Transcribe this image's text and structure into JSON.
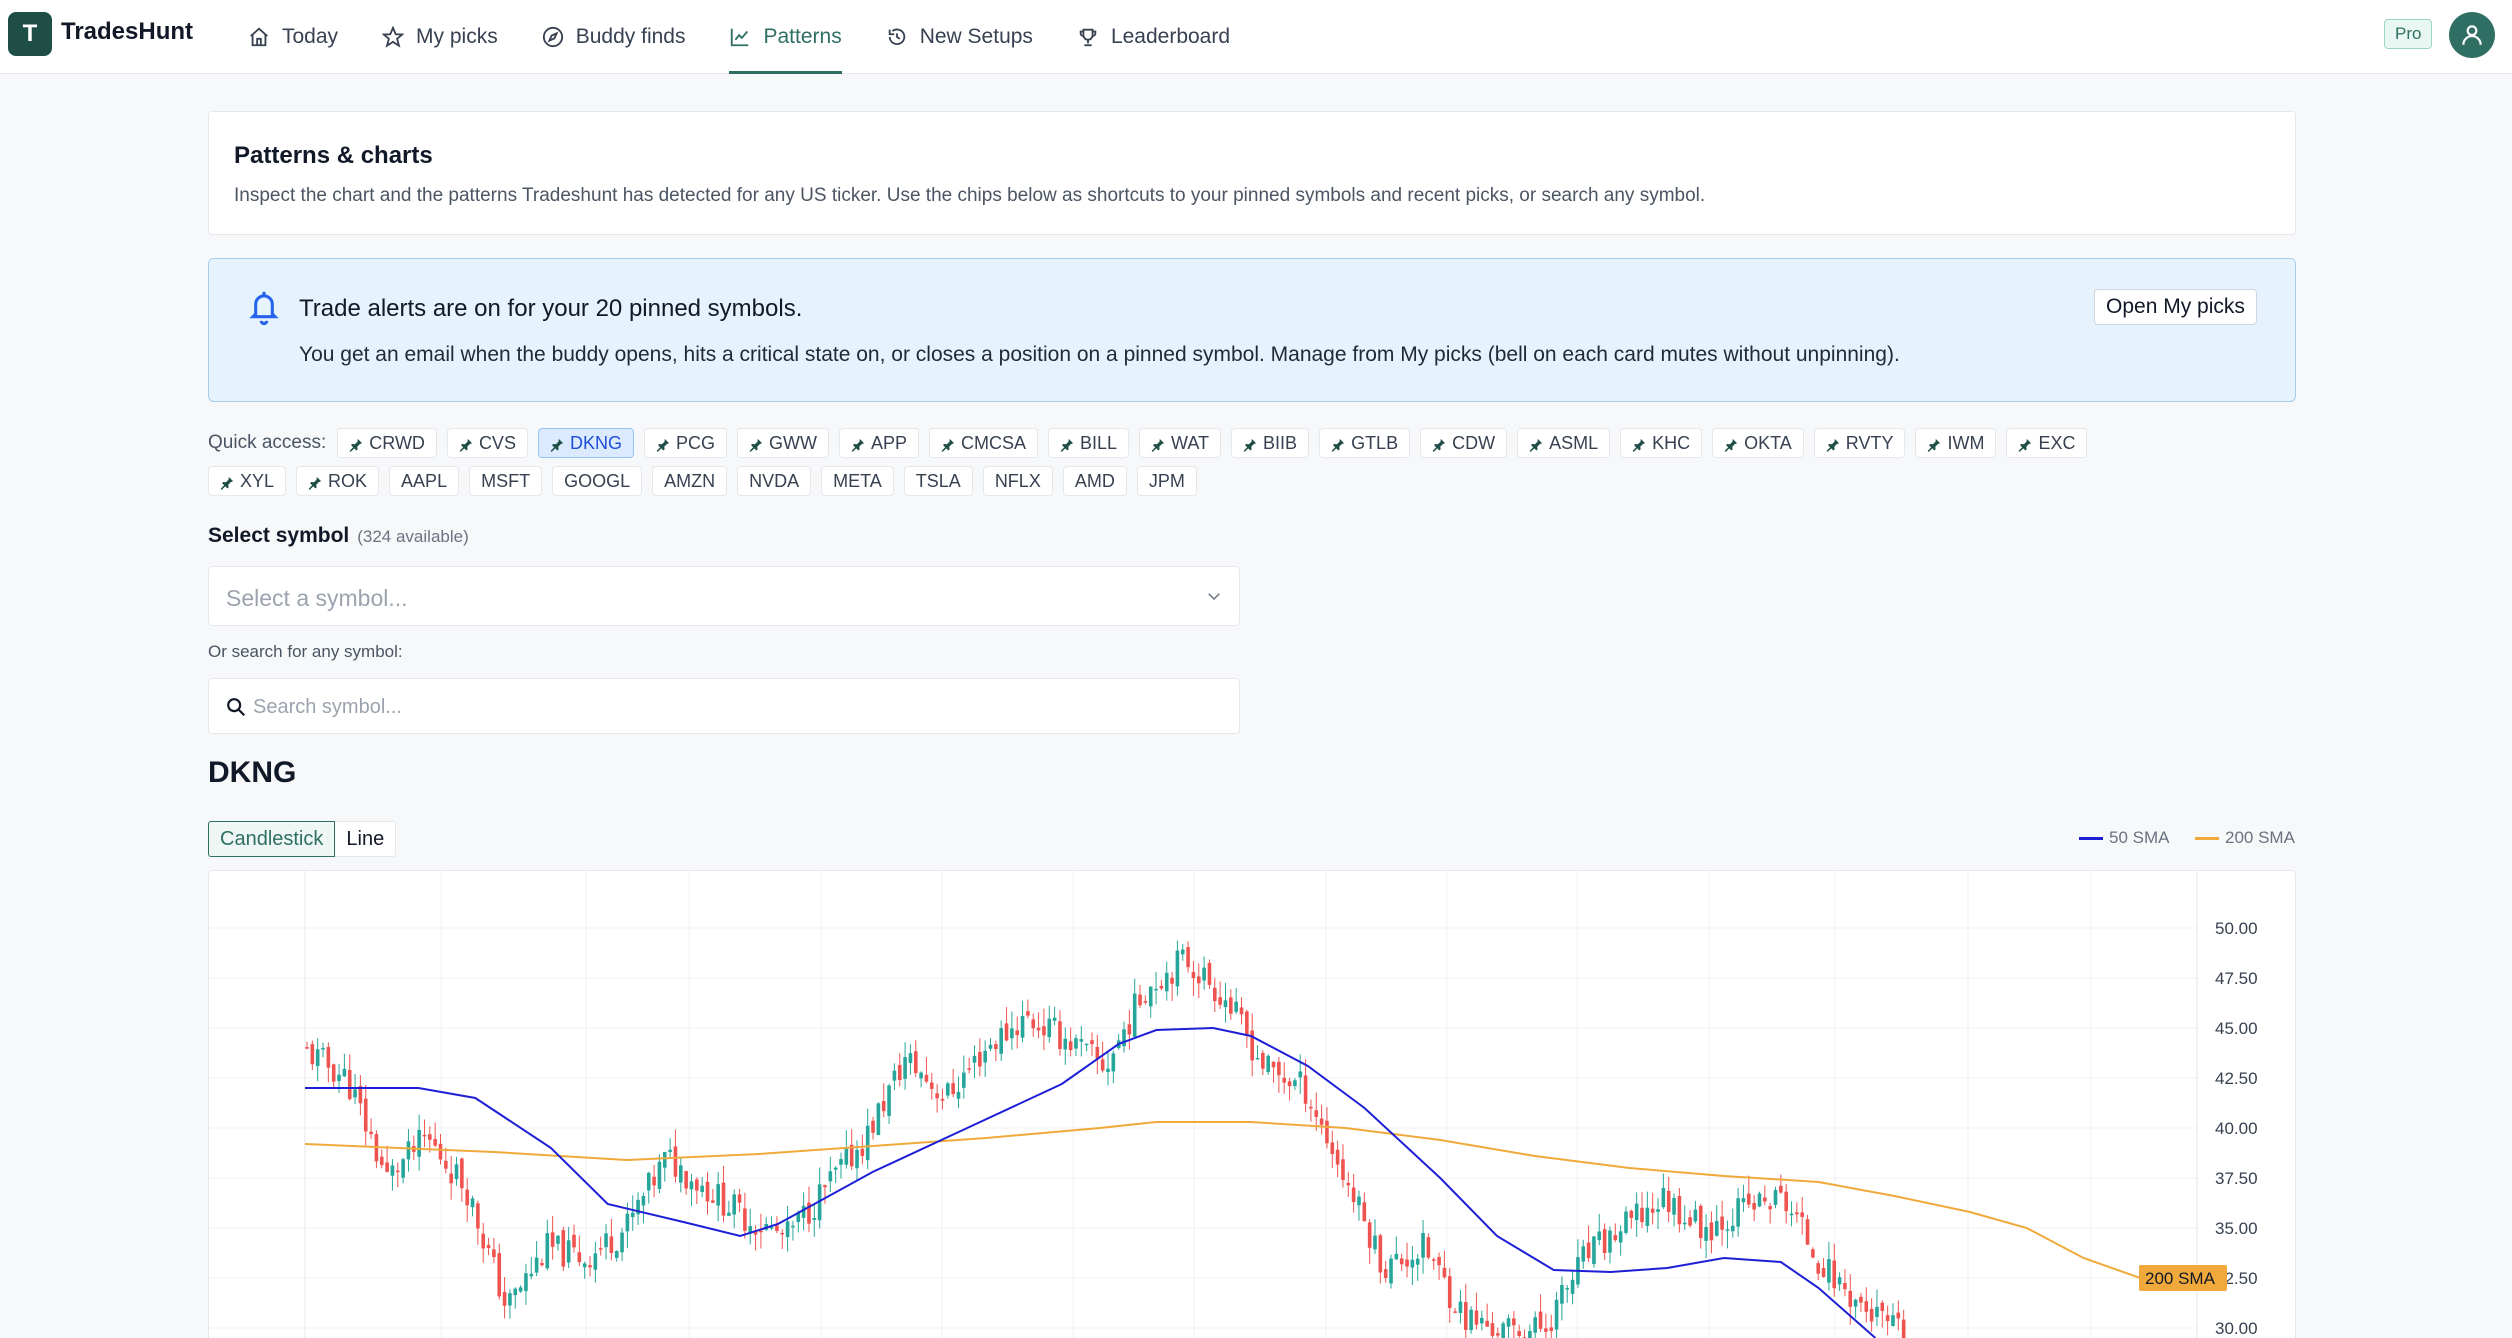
{
  "app": {
    "logo_letter": "T",
    "name": "TradesHunt"
  },
  "nav": [
    {
      "label": "Today",
      "icon": "home-icon",
      "active": false
    },
    {
      "label": "My picks",
      "icon": "star-icon",
      "active": false
    },
    {
      "label": "Buddy finds",
      "icon": "compass-icon",
      "active": false
    },
    {
      "label": "Patterns",
      "icon": "chart-line-icon",
      "active": true
    },
    {
      "label": "New Setups",
      "icon": "history-icon",
      "active": false
    },
    {
      "label": "Leaderboard",
      "icon": "trophy-icon",
      "active": false
    }
  ],
  "badge": "Pro",
  "intro": {
    "title": "Patterns & charts",
    "text": "Inspect the chart and the patterns Tradeshunt has detected for any US ticker. Use the chips below as shortcuts to your pinned symbols and recent picks, or search any symbol."
  },
  "alert": {
    "title": "Trade alerts are on for your 20 pinned symbols.",
    "body": "You get an email when the buddy opens, hits a critical state on, or closes a position on a pinned symbol. Manage from My picks (bell on each card mutes without unpinning).",
    "button": "Open My picks"
  },
  "quick_access": {
    "label": "Quick access:",
    "selected": "DKNG",
    "pinned": [
      "CRWD",
      "CVS",
      "DKNG",
      "PCG",
      "GWW",
      "APP",
      "CMCSA",
      "BILL",
      "WAT",
      "BIIB",
      "GTLB",
      "CDW",
      "ASML",
      "KHC",
      "OKTA",
      "RVTY",
      "IWM",
      "EXC",
      "XYL",
      "ROK"
    ],
    "recent": [
      "AAPL",
      "MSFT",
      "GOOGL",
      "AMZN",
      "NVDA",
      "META",
      "TSLA",
      "NFLX",
      "AMD",
      "JPM"
    ]
  },
  "selector": {
    "label": "Select symbol",
    "available": "(324 available)",
    "placeholder": "Select a symbol...",
    "or_label": "Or search for any symbol:",
    "search_placeholder": "Search symbol..."
  },
  "symbol": "DKNG",
  "chart_toggle": {
    "options": [
      "Candlestick",
      "Line"
    ],
    "selected": "Candlestick"
  },
  "legend": [
    {
      "label": "50 SMA",
      "color": "#1d1fd6"
    },
    {
      "label": "200 SMA",
      "color": "#f0a93a"
    }
  ],
  "chart_data": {
    "type": "candlestick",
    "symbol": "DKNG",
    "y_ticks": [
      "50.00",
      "47.50",
      "45.00",
      "42.50",
      "40.00",
      "37.50",
      "35.00",
      "32.50",
      "30.00"
    ],
    "ylim": [
      29.5,
      51
    ],
    "y_axis_position": "right",
    "grid": true,
    "up_color": "#26a69a",
    "down_color": "#ef5350",
    "close_anchors": [
      43.8,
      42.5,
      37.5,
      39.5,
      37.0,
      31.0,
      34.0,
      33.5,
      35.0,
      38.5,
      37.0,
      35.5,
      34.5,
      37.0,
      39.5,
      43.5,
      41.5,
      44.0,
      45.5,
      44.5,
      43.0,
      47.0,
      48.5,
      46.5,
      43.0,
      42.0,
      37.5,
      33.0,
      34.0,
      30.5,
      29.8,
      30.0,
      33.5,
      35.0,
      36.5,
      35.0,
      36.0,
      36.5,
      33.0,
      31.0,
      29.5
    ],
    "sma50": [
      {
        "x": 0,
        "y": 42.0
      },
      {
        "x": 0.06,
        "y": 42.0
      },
      {
        "x": 0.09,
        "y": 41.5
      },
      {
        "x": 0.13,
        "y": 39.0
      },
      {
        "x": 0.16,
        "y": 36.2
      },
      {
        "x": 0.2,
        "y": 35.3
      },
      {
        "x": 0.23,
        "y": 34.6
      },
      {
        "x": 0.25,
        "y": 35.2
      },
      {
        "x": 0.3,
        "y": 37.8
      },
      {
        "x": 0.35,
        "y": 40.0
      },
      {
        "x": 0.4,
        "y": 42.2
      },
      {
        "x": 0.43,
        "y": 44.2
      },
      {
        "x": 0.45,
        "y": 44.9
      },
      {
        "x": 0.48,
        "y": 45.0
      },
      {
        "x": 0.5,
        "y": 44.6
      },
      {
        "x": 0.53,
        "y": 43.1
      },
      {
        "x": 0.56,
        "y": 41.0
      },
      {
        "x": 0.6,
        "y": 37.5
      },
      {
        "x": 0.63,
        "y": 34.6
      },
      {
        "x": 0.66,
        "y": 32.9
      },
      {
        "x": 0.69,
        "y": 32.8
      },
      {
        "x": 0.72,
        "y": 33.0
      },
      {
        "x": 0.75,
        "y": 33.5
      },
      {
        "x": 0.78,
        "y": 33.3
      },
      {
        "x": 0.8,
        "y": 32.0
      },
      {
        "x": 0.83,
        "y": 29.5
      }
    ],
    "sma200": [
      {
        "x": 0,
        "y": 39.2
      },
      {
        "x": 0.1,
        "y": 38.8
      },
      {
        "x": 0.17,
        "y": 38.4
      },
      {
        "x": 0.24,
        "y": 38.7
      },
      {
        "x": 0.3,
        "y": 39.1
      },
      {
        "x": 0.36,
        "y": 39.5
      },
      {
        "x": 0.42,
        "y": 40.0
      },
      {
        "x": 0.45,
        "y": 40.3
      },
      {
        "x": 0.5,
        "y": 40.3
      },
      {
        "x": 0.55,
        "y": 40.0
      },
      {
        "x": 0.6,
        "y": 39.4
      },
      {
        "x": 0.65,
        "y": 38.6
      },
      {
        "x": 0.7,
        "y": 38.0
      },
      {
        "x": 0.75,
        "y": 37.6
      },
      {
        "x": 0.8,
        "y": 37.3
      },
      {
        "x": 0.84,
        "y": 36.6
      },
      {
        "x": 0.88,
        "y": 35.8
      },
      {
        "x": 0.91,
        "y": 35.0
      },
      {
        "x": 0.94,
        "y": 33.5
      },
      {
        "x": 0.97,
        "y": 32.5
      },
      {
        "x": 1,
        "y": 32.4
      }
    ],
    "price_label": {
      "text": "200 SMA",
      "value": 32.5,
      "color": "#f0a93a"
    }
  }
}
